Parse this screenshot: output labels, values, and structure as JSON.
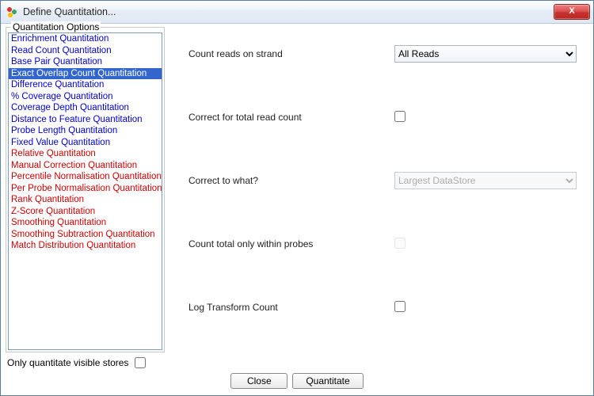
{
  "window": {
    "title": "Define Quantitation...",
    "close_symbol": "X"
  },
  "sidebar": {
    "legend": "Quantitation Options",
    "items": [
      {
        "label": "Enrichment Quantitation",
        "group": "blue",
        "selected": false
      },
      {
        "label": "Read Count Quantitation",
        "group": "blue",
        "selected": false
      },
      {
        "label": "Base Pair Quantitation",
        "group": "blue",
        "selected": false
      },
      {
        "label": "Exact Overlap Count Quantitation",
        "group": "blue",
        "selected": true
      },
      {
        "label": "Difference Quantitation",
        "group": "blue",
        "selected": false
      },
      {
        "label": "% Coverage Quantitation",
        "group": "blue",
        "selected": false
      },
      {
        "label": "Coverage Depth Quantitation",
        "group": "blue",
        "selected": false
      },
      {
        "label": "Distance to Feature Quantitation",
        "group": "blue",
        "selected": false
      },
      {
        "label": "Probe Length Quantitation",
        "group": "blue",
        "selected": false
      },
      {
        "label": "Fixed Value Quantitation",
        "group": "blue",
        "selected": false
      },
      {
        "label": "Relative Quantitation",
        "group": "red",
        "selected": false
      },
      {
        "label": "Manual Correction Quantitation",
        "group": "red",
        "selected": false
      },
      {
        "label": "Percentile Normalisation Quantitation",
        "group": "red",
        "selected": false
      },
      {
        "label": "Per Probe Normalisation Quantitation",
        "group": "red",
        "selected": false
      },
      {
        "label": "Rank Quantitation",
        "group": "red",
        "selected": false
      },
      {
        "label": "Z-Score Quantitation",
        "group": "red",
        "selected": false
      },
      {
        "label": "Smoothing Quantitation",
        "group": "red",
        "selected": false
      },
      {
        "label": "Smoothing Subtraction Quantitation",
        "group": "red",
        "selected": false
      },
      {
        "label": "Match Distribution Quantitation",
        "group": "red",
        "selected": false
      }
    ]
  },
  "form": {
    "rows": {
      "strand": {
        "label": "Count reads on strand",
        "value": "All Reads"
      },
      "correct_tot": {
        "label": "Correct for total read count",
        "checked": false
      },
      "correct_to": {
        "label": "Correct to what?",
        "value": "Largest DataStore",
        "disabled": true
      },
      "within": {
        "label": "Count total only within probes",
        "checked": false,
        "disabled": true
      },
      "logt": {
        "label": "Log Transform Count",
        "checked": false
      }
    }
  },
  "footer": {
    "only_visible_label": "Only quantitate visible stores",
    "only_visible_checked": false,
    "close": "Close",
    "quantitate": "Quantitate"
  }
}
